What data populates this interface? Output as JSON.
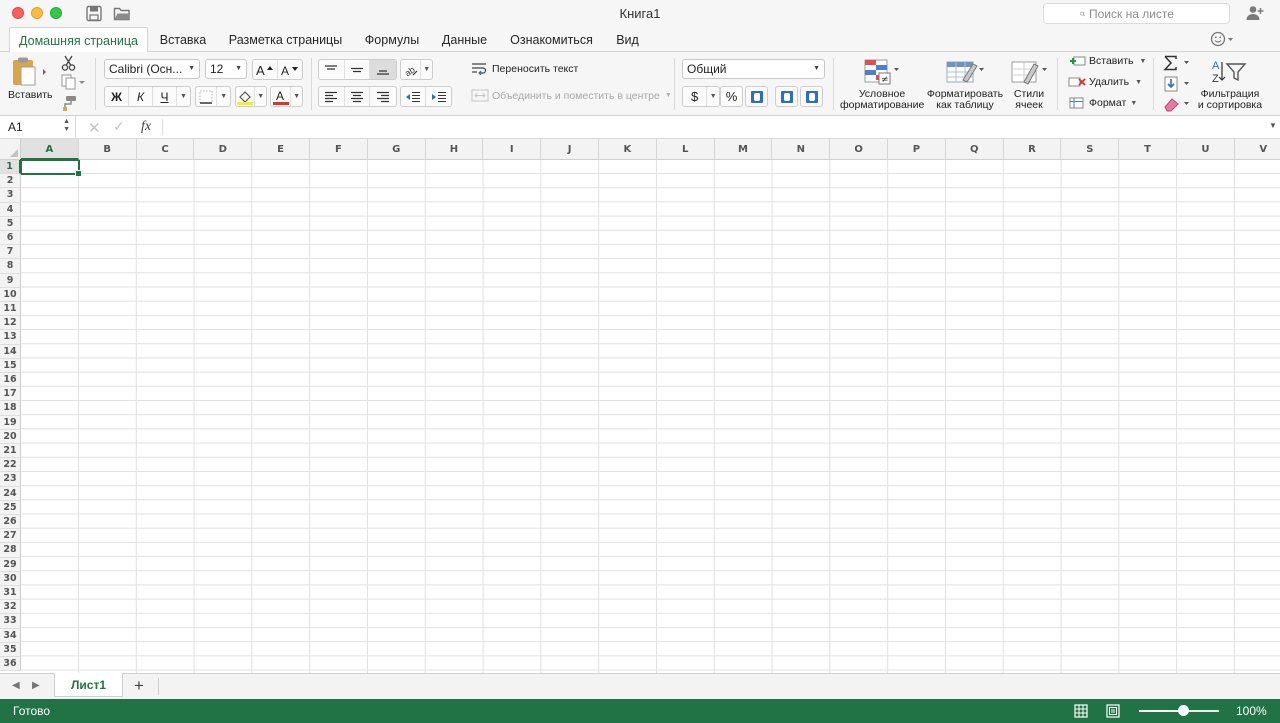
{
  "window": {
    "title": "Книга1"
  },
  "search": {
    "placeholder": "Поиск на листе"
  },
  "tabs": [
    {
      "label": "Домашняя страница"
    },
    {
      "label": "Вставка"
    },
    {
      "label": "Разметка страницы"
    },
    {
      "label": "Формулы"
    },
    {
      "label": "Данные"
    },
    {
      "label": "Ознакомиться"
    },
    {
      "label": "Вид"
    }
  ],
  "ribbon": {
    "paste_label": "Вставить",
    "font_name": "Calibri (Осн...",
    "font_size": "12",
    "bold": "Ж",
    "italic": "К",
    "underline": "Ч",
    "wrap_text": "Переносить текст",
    "merge_center": "Объединить и поместить в центре",
    "number_format": "Общий",
    "currency": "$",
    "percent": "%",
    "cond_format_1": "Условное",
    "cond_format_2": "форматирование",
    "format_table_1": "Форматировать",
    "format_table_2": "как таблицу",
    "cell_styles_1": "Стили",
    "cell_styles_2": "ячеек",
    "insert_cells": "Вставить",
    "delete_cells": "Удалить",
    "format_cells": "Формат",
    "filter_sort_1": "Фильтрация",
    "filter_sort_2": "и сортировка"
  },
  "formula_bar": {
    "name_box": "A1",
    "fx": "fx",
    "value": ""
  },
  "grid": {
    "columns": [
      "A",
      "B",
      "C",
      "D",
      "E",
      "F",
      "G",
      "H",
      "I",
      "J",
      "K",
      "L",
      "M",
      "N",
      "O",
      "P",
      "Q",
      "R",
      "S",
      "T",
      "U",
      "V"
    ],
    "rows": [
      "1",
      "2",
      "3",
      "4",
      "5",
      "6",
      "7",
      "8",
      "9",
      "10",
      "11",
      "12",
      "13",
      "14",
      "15",
      "16",
      "17",
      "18",
      "19",
      "20",
      "21",
      "22",
      "23",
      "24",
      "25",
      "26",
      "27",
      "28",
      "29",
      "30",
      "31",
      "32",
      "33",
      "34",
      "35",
      "36"
    ],
    "selected_cell": "A1"
  },
  "sheets": {
    "tabs": [
      {
        "label": "Лист1"
      }
    ],
    "add": "+"
  },
  "status": {
    "text": "Готово",
    "zoom": "100%",
    "zoom_fraction": 0.55
  },
  "colors": {
    "accent": "#217346",
    "gridline": "#e1e1e1",
    "header_bg": "#f3f3f3"
  }
}
